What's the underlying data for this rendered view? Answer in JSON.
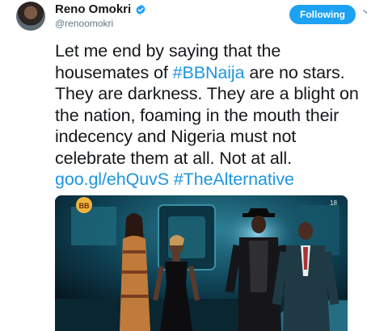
{
  "tweet": {
    "author": {
      "display_name": "Reno Omokri",
      "handle": "@renoomokri",
      "verified_icon": "verified-badge-icon"
    },
    "follow_button_label": "Following",
    "menu_icon": "chevron-down-icon",
    "text": {
      "part1": "Let me end by saying that the housemates of ",
      "hashtag1": "#BBNaija",
      "part2": " are no stars. They are darkness. They are a blight on the nation, foaming in the mouth their indecency and Nigeria must not celebrate them at all. Not at all.",
      "link": "goo.gl/ehQuvS",
      "hashtag2": "#TheAlternative"
    },
    "media": {
      "logo_text": "BB",
      "corner_badge": "18"
    }
  },
  "colors": {
    "brand_blue": "#1da1f2",
    "link_blue": "#1b95e0",
    "text_dark": "#14171a",
    "text_gray": "#657786"
  }
}
